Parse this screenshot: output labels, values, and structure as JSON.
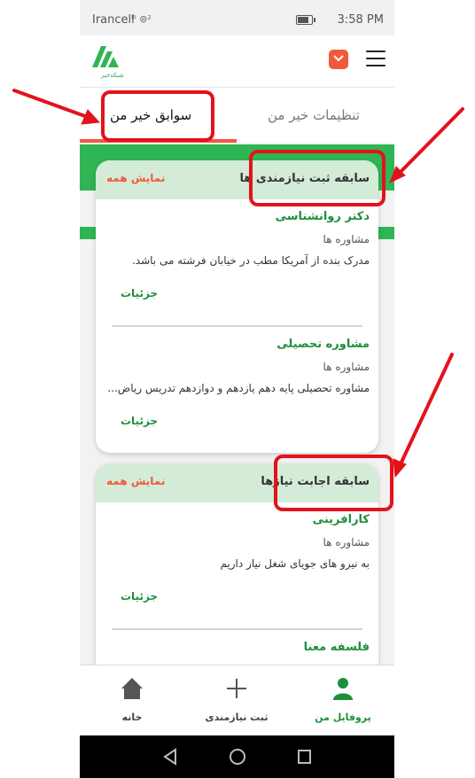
{
  "status_bar": {
    "carrier": "Irancell",
    "signal_text": "ᴵˡˡ ⊚²",
    "time": "3:58 PM"
  },
  "app_bar": {
    "logo_text": "شبکه‌خیر",
    "logo_icon": "logo-icon",
    "bag_icon": "shopping-bag-icon",
    "menu_icon": "hamburger-menu-icon"
  },
  "tabs": {
    "active": "سوابق خیر من",
    "inactive": "تنظیمات خیر من"
  },
  "cards": [
    {
      "title": "سابقه ثبت نیازمندی ها",
      "show_all": "نمایش همه",
      "items": [
        {
          "title": "دکتر روانشناسی",
          "category": "مشاوره ها",
          "description": "مدرک بنده از آمریکا مطب در خیابان فرشته می باشد.",
          "details": "جزئیات"
        },
        {
          "title": "مشاوره تحصیلی",
          "category": "مشاوره ها",
          "description": "مشاوره تحصیلی پایه دهم یازدهم و دوازدهم تدریس ریاض...",
          "details": "جزئیات"
        }
      ]
    },
    {
      "title": "سابقه اجابت نیازها",
      "show_all": "نمایش همه",
      "items": [
        {
          "title": "کارافرینی",
          "category": "مشاوره ها",
          "description": "به نیرو های جویای شغل نیاز داریم",
          "details": "جزئیات"
        },
        {
          "title": "فلسفه معنا",
          "category": "",
          "description": "",
          "details": ""
        }
      ]
    }
  ],
  "bottom_nav": {
    "home": "خانه",
    "add": "ثبت نیازمندی",
    "profile": "پروفایل من"
  },
  "colors": {
    "green": "#2fb553",
    "orange": "#f05a3c",
    "header_green": "#d4ebd8",
    "annotation_red": "#e3121b"
  }
}
